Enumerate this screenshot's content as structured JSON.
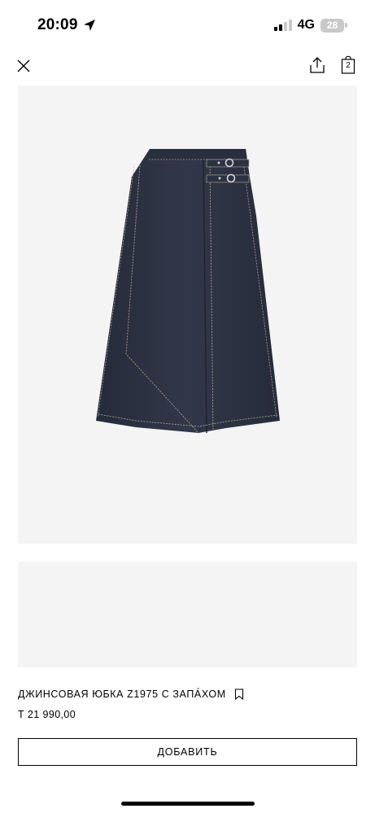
{
  "status_bar": {
    "time": "20:09",
    "network": "4G",
    "battery_level": "28",
    "icons": [
      "location-arrow-icon",
      "signal-bars-icon",
      "battery-icon"
    ]
  },
  "header": {
    "bag_count": "2",
    "icons": [
      "close-icon",
      "share-icon",
      "shopping-bag-icon"
    ]
  },
  "product": {
    "image_description_icon": "denim-skirt-image",
    "title": "ДЖИНСОВАЯ ЮБКА Z1975 С ЗАПА́ХОМ",
    "price": "Т 21 990,00",
    "add_button_label": "ДОБАВИТЬ"
  },
  "colors": {
    "background": "#ffffff",
    "image_background": "#f4f4f4",
    "denim": "#2b3142",
    "stitching": "#b9ad93",
    "text": "#000000"
  }
}
